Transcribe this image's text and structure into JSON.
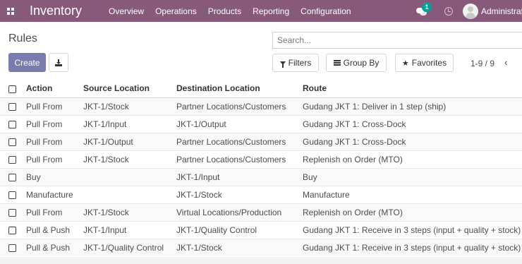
{
  "navbar": {
    "app_name": "Inventory",
    "menu": [
      "Overview",
      "Operations",
      "Products",
      "Reporting",
      "Configuration"
    ],
    "chat_badge": "1",
    "user_name": "Administrator",
    "bg_color": "#875a7b"
  },
  "control_panel": {
    "breadcrumb": "Rules",
    "search_placeholder": "Search...",
    "create_label": "Create",
    "download_icon": "download-icon",
    "filters_label": "Filters",
    "group_by_label": "Group By",
    "favorites_label": "Favorites",
    "pager": "1-9 / 9",
    "pager_prev": "‹",
    "accent_color": "#7c7bad"
  },
  "table": {
    "columns": [
      "Action",
      "Source Location",
      "Destination Location",
      "Route"
    ],
    "rows": [
      {
        "action": "Pull From",
        "source": "JKT-1/Stock",
        "destination": "Partner Locations/Customers",
        "route": "Gudang JKT 1: Deliver in 1 step (ship)"
      },
      {
        "action": "Pull From",
        "source": "JKT-1/Input",
        "destination": "JKT-1/Output",
        "route": "Gudang JKT 1: Cross-Dock"
      },
      {
        "action": "Pull From",
        "source": "JKT-1/Output",
        "destination": "Partner Locations/Customers",
        "route": "Gudang JKT 1: Cross-Dock"
      },
      {
        "action": "Pull From",
        "source": "JKT-1/Stock",
        "destination": "Partner Locations/Customers",
        "route": "Replenish on Order (MTO)"
      },
      {
        "action": "Buy",
        "source": "",
        "destination": "JKT-1/Input",
        "route": "Buy"
      },
      {
        "action": "Manufacture",
        "source": "",
        "destination": "JKT-1/Stock",
        "route": "Manufacture"
      },
      {
        "action": "Pull From",
        "source": "JKT-1/Stock",
        "destination": "Virtual Locations/Production",
        "route": "Replenish on Order (MTO)"
      },
      {
        "action": "Pull & Push",
        "source": "JKT-1/Input",
        "destination": "JKT-1/Quality Control",
        "route": "Gudang JKT 1: Receive in 3 steps (input + quality + stock)"
      },
      {
        "action": "Pull & Push",
        "source": "JKT-1/Quality Control",
        "destination": "JKT-1/Stock",
        "route": "Gudang JKT 1: Receive in 3 steps (input + quality + stock)"
      }
    ]
  }
}
